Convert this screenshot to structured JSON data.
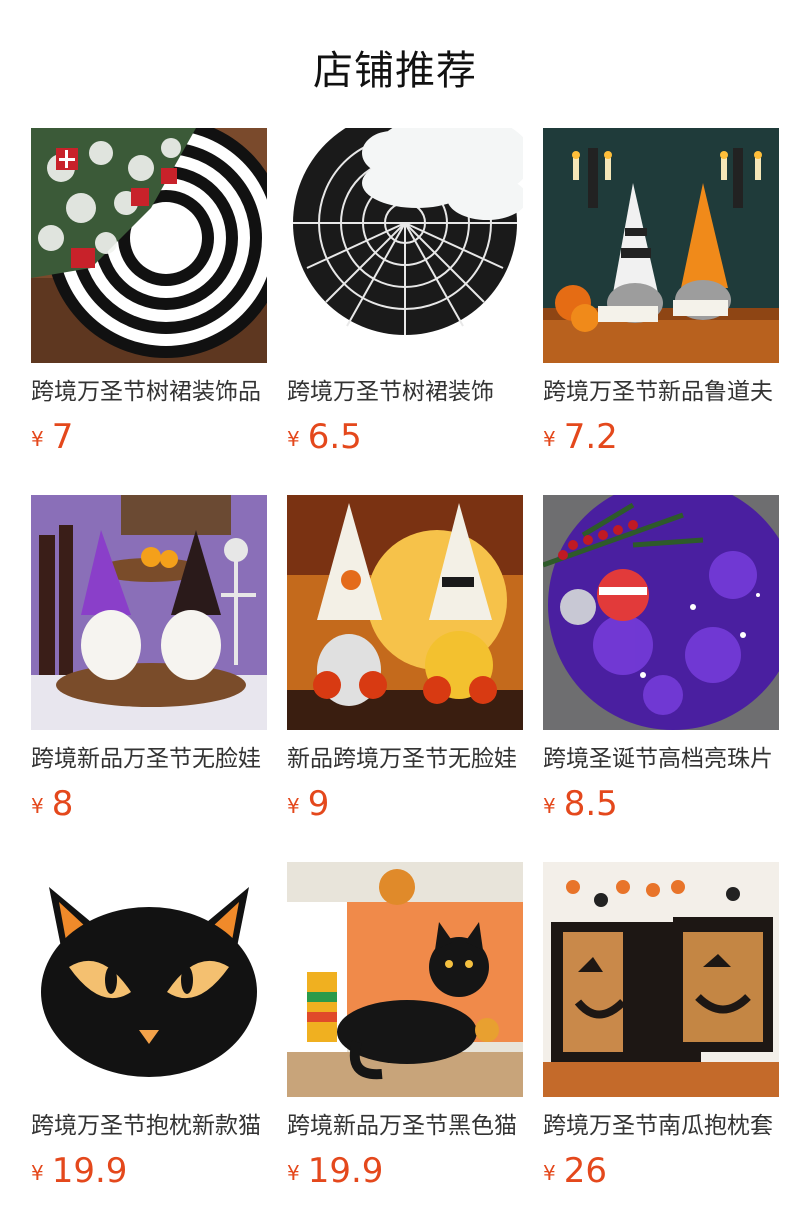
{
  "header": {
    "title": "店铺推荐"
  },
  "colors": {
    "price": "#e4481c",
    "title": "#111111",
    "name": "#333333"
  },
  "products": [
    {
      "name": "跨境万圣节树裙装饰品",
      "currency": "¥",
      "price": "7",
      "image": "white christmas tree on black and white swirl tree skirt",
      "icon": "tree-skirt-swirl-image"
    },
    {
      "name": "跨境万圣节树裙装饰",
      "currency": "¥",
      "price": "6.5",
      "image": "white tree over black spider web tree skirt",
      "icon": "tree-skirt-spiderweb-image"
    },
    {
      "name": "跨境万圣节新品鲁道夫",
      "currency": "¥",
      "price": "7.2",
      "image": "two halloween gnomes holding BOO signs with candles",
      "icon": "gnome-boo-image"
    },
    {
      "name": "跨境新品万圣节无脸娃",
      "currency": "¥",
      "price": "8",
      "image": "purple and orange witch gnomes on wooden tray",
      "icon": "witch-gnome-image"
    },
    {
      "name": "新品跨境万圣节无脸娃",
      "currency": "¥",
      "price": "9",
      "image": "trick or treat and happy halloween gnomes at full moon",
      "icon": "trick-treat-gnome-image"
    },
    {
      "name": "跨境圣诞节高档亮珠片",
      "currency": "¥",
      "price": "8.5",
      "image": "purple sequin tree skirt with ornaments",
      "icon": "purple-sequin-skirt-image"
    },
    {
      "name": "跨境万圣节抱枕新款猫",
      "currency": "¥",
      "price": "19.9",
      "image": "black cat face cushion",
      "icon": "black-cat-pillow-image"
    },
    {
      "name": "跨境新品万圣节黑色猫",
      "currency": "¥",
      "price": "19.9",
      "image": "black cat plush on orange table",
      "icon": "black-cat-plush-image"
    },
    {
      "name": "跨境万圣节南瓜抱枕套",
      "currency": "¥",
      "price": "26",
      "image": "sequin jack-o-lantern pillow covers on sofa",
      "icon": "pumpkin-pillow-image"
    }
  ]
}
